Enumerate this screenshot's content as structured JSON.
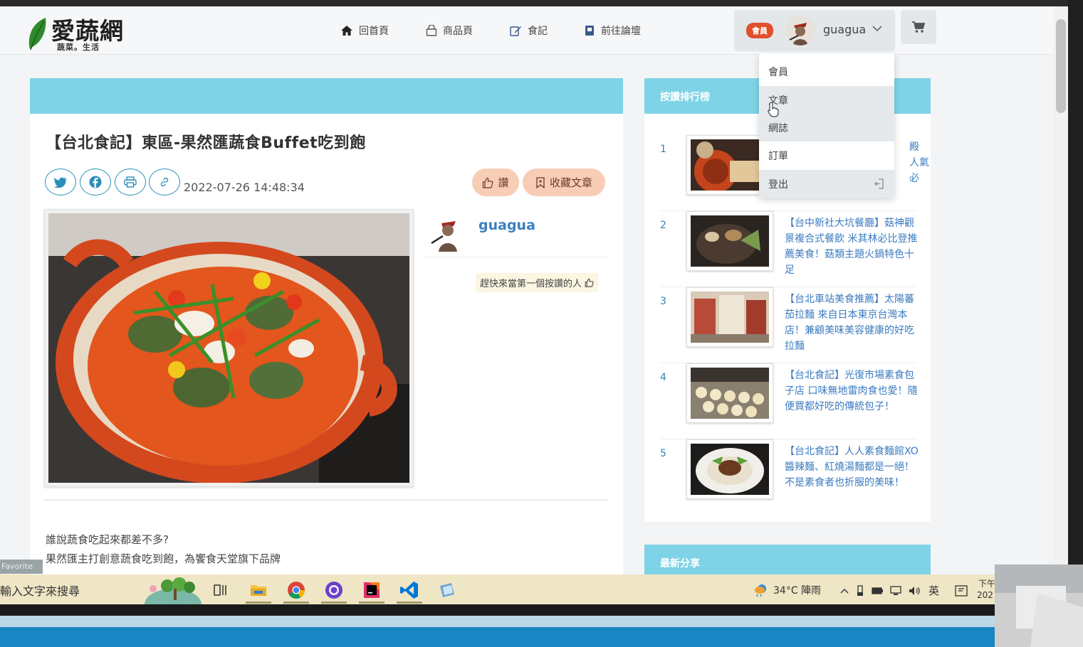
{
  "site": {
    "logo_text": "愛蔬網",
    "logo_sub": "蔬菜。生活"
  },
  "nav": {
    "home": "回首頁",
    "products": "商品頁",
    "food_notes": "食記",
    "forum": "前往論壇"
  },
  "member": {
    "badge": "會員",
    "username": "guagua"
  },
  "dropdown": {
    "items": [
      "會員",
      "文章",
      "網誌",
      "訂單",
      "登出"
    ]
  },
  "article": {
    "title": "【台北食記】東區-果然匯蔬食Buffet吃到飽",
    "date": "2022-07-26 14:48:34",
    "like_label": "讚",
    "bookmark_label": "收藏文章",
    "author": "guagua",
    "first_like_prompt": "趕快來當第一個按讚的人",
    "body_lines": [
      "誰說蔬食吃起來都差不多?",
      "果然匯主打創意蔬食吃到飽，為饗食天堂旗下品牌"
    ]
  },
  "sidebar": {
    "ranking_title": "按讚排行榜",
    "latest_title": "最新分享",
    "items": [
      {
        "rank": "1",
        "text": "殿\n人氣\n必"
      },
      {
        "rank": "2",
        "text": "【台中新社大坑餐廳】菇神觀景複合式餐飲 米其林必比登推薦美食！菇類主題火鍋特色十足"
      },
      {
        "rank": "3",
        "text": "【台北車站美食推薦】太陽蕃茄拉麵 來自日本東京台灣本店！兼顧美味美容健康的好吃拉麵"
      },
      {
        "rank": "4",
        "text": "【台北食記】光復市場素食包子店 口味無地雷肉食也愛！隨便買都好吃的傳統包子！"
      },
      {
        "rank": "5",
        "text": "【台北食記】人人素食麵館XO醬辣麵、紅燒湯麵都是一絕！不是素食者也折服的美味！"
      }
    ]
  },
  "taskbar": {
    "search_placeholder": "輸入文字來搜尋",
    "favorite_tag": "Favorite",
    "weather": "34°C 陣雨",
    "ime": "英",
    "clock_line1": "下午",
    "clock_line2": "202"
  },
  "colors": {
    "header_accent": "#7fd3e6",
    "link_blue": "#3a7bc0",
    "pill_bg": "#f7cdb6",
    "badge_orange": "#e0502a"
  },
  "icons": [
    "home-icon",
    "bag-icon",
    "edit-icon",
    "book-icon",
    "chevron-down-icon",
    "cart-icon",
    "twitter-icon",
    "facebook-icon",
    "print-icon",
    "link-icon",
    "thumb-up-icon",
    "bookmark-icon",
    "logout-icon"
  ]
}
